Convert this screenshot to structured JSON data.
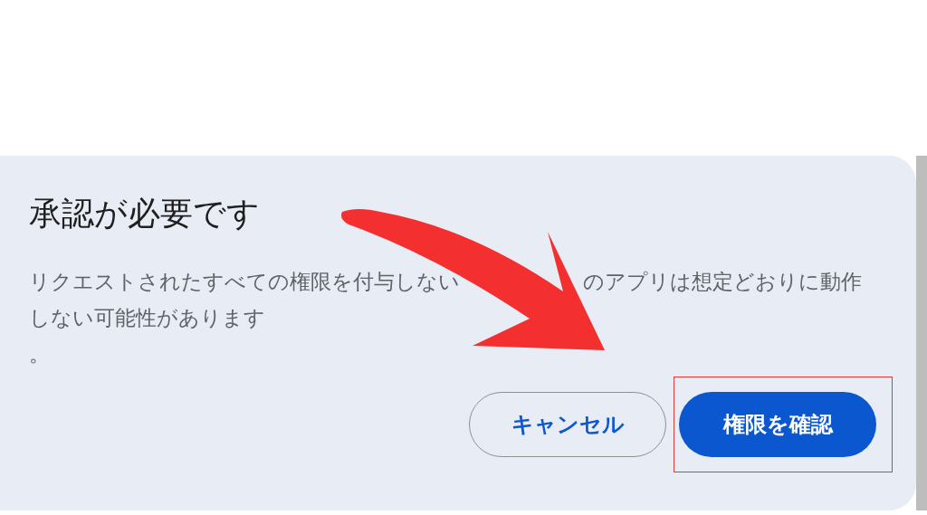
{
  "dialog": {
    "title": "承認が必要です",
    "message": [
      "リクエストされたすべての権限を付与しない",
      "のアプリは想定どおりに動作",
      "しない可能性があります",
      "。"
    ],
    "buttons": [
      {
        "label": "キャンセル",
        "kind": "secondary"
      },
      {
        "label": "権限を確認",
        "kind": "primary",
        "highlighted": true
      }
    ]
  }
}
